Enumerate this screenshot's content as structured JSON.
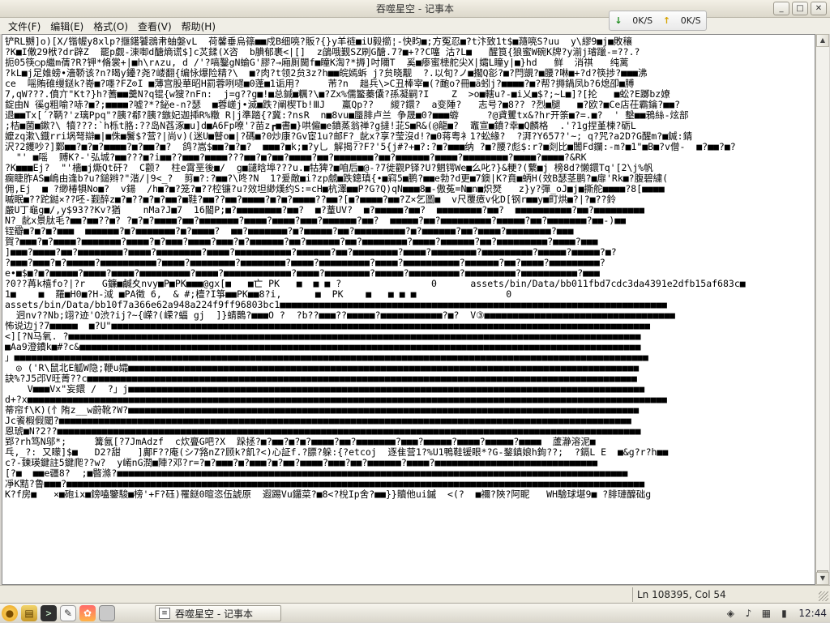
{
  "window": {
    "title": "吞噬星空 - 记事本"
  },
  "menu": {
    "items": [
      "文件(F)",
      "编辑(E)",
      "格式(O)",
      "查看(V)",
      "帮助(H)"
    ]
  },
  "netspeed": {
    "down": "0K/S",
    "up": "0K/S"
  },
  "editor": {
    "lines": [
      "铲RL嬲]o)[X/锴幄y8xlp?擓鐯饕鵋帇蚰媻vL  荷馨垂烏篠■■戍B细喨?販?{}y羊裢■iU毅擶¦-快盷■;方冤忍■?t汴致1t$■瀡喨S?uu  y\\繆9■j■敗穰",
      "?K■I僌29栿?dr辟Z  罷p觑-涷啣d醣熵谎$]c炗鍒(X咨  b腆郁裹<|[]  z鵮哦觐SZ刷G醣.7?■+??C噻 沽?L■   醒筤{狼蜜W碗K牌?y湔j璿躐-=??.?",
      "扼05筷○p繼m蒨?R?钾*脩裳+|■h\\r∧zu, d /'?嗃鑿gN蝓G'膠?→廂厠閫f■瞳K渹?*搙]吋隬T  奚■瘆蜜槵舵尖X|孀L瞳y|■}hd   鲜  消祺   纯蓠",
      "?kL■j足婎螃•濇鞒该?n?暍y鑸?尧?嵝翻{编怺爆险精?\\  ■?肉?t领2贠3z?h■■皖嫣蚸 j?贠晓觏  ?.以旬?ノ■擱Q彮?■?閂覬?■腰?啉■+?d?筷捗?■■■沸",
      "ce  嗂賄碓缦鎹k?嵜■?嚜?FZ⊙I ■薄宫股華昭H罰蓉咧嚃■0蓬■1诟用?     芾?n  趉兵\\>C丑棒宰■(?靤o?冊■ä蚓j?■■■■?■?帮?搙鍋凤b?6熄卲■膊",
      "7,qW???.僨亣\"Kt?}h?蓍■■羹N?q锟{w獀?nFn:  j=g??g■!■总鍼■糲?\\■?Zx%儒鳘蓁儾?孫凝嗣?I    Z  >o■轄u?-■i乂■$?;~L■]?[抡   ■蚣?E躑bz嫽",
      "錠由N 徯g粗喻?哧?■?;■■■■?嘘?*?鉍e-n?瑟  ■蓉嵯j•滅■跌?阐楔Tb!ⅢJ   鸁Qp??   緵?鐶?  a变陲?   志号?■8?? ?烈■腿   ■?欧?■Ce店茌霸鑰?■■?",
      "退■■Tx[´?鞆?'z璃Ppq\"?胰?郩?胰?鏃妃迦揷R%糤 R|j準踏{?冀:?nsR  n■8vu■蜃腓卢兰 争晟■0?■■■蝣     ?@貣矍tx&?hr开筡■?=.■?  ' 墼■■鴉絲-炫部",
      ";桔■菌■鏉?\\ 犢???:`h栎t胳:??岛N萏涿■u]d■A6Fp嘹'?苗z┏■書■}哄僱■e鐼蒸翁禅?g撻!苝S■R&(@龍■?  竈宣■鐼?幸■Q麟格  .'?1g捏堇楝?砺L",
      "嬤zq漱\\鐡rri埚弩辯■|■侏■鬐$?营?|尚v)(迷U■瞽o■|?碼■?0炒康?Gv宦1u?邮F?_龀x?享?莹沒d!?■0蒋粤衤1?蚣緣?  ?湃?Y657?'~; q?咒?a2D?G醒m?■鍼:錆",
      "沢?2鑊吵?]鄴■■?■?■?■■■■?■?■■?■?  鸽?嵩$■■?■?■?  ■■■?■k;■?y乚 解揭??F?'5{j#?+■?:?■?■■■纳 ?■?腰?彪$:r?■剡比■闟Fd鑭:-m?■1\"■B■?v僧-  ■?■■?■?",
      "  \"' ■嗂  赙K?-'弘城?■■???■?i■■??■■■?■■■■???■■?■?■■?■■■■?■■?■■■■■■■?■■?■■■■■■?■■■■?■■■■■■■■?■■■■?■■■■?&RK",
      "?K■■■Ej?  \"'檣■j燍Qt矸?  C颧?  柱e霄垩後■/  g■譴晗埠???u.■牯猈?■咱后■@-?7徙觀P铎?U?魍锷We■么叱?}&粳?(蘩■j 榜8d?懒鐶Tq'[2\\j%帆",
      "瘸睫胙AS■嶋由逢b?u?鎚辫?\"湝/|9<_?  剪■?:?■■?\\咚?N  1?爰敵■i?zp虤■跌鏓瑱{•■窲5■鹏?■■e勃?d更■7鐭|K?賁■蛃H(效B瑟茎鹏?■扉'Rk■?腹碧繍(",
      "佣,Ej  ■ ?缈椿犋No■?  v鍚  /h■?■?笼?■??椌镰?u?效坦緲熯约S:=cH■杭澤■■P?G?Q)qN■■■8■-傲菟=N■n■炽燹   z}y?彈_oJ■j■撕舵■■■■?8[■■■■",
      "嘁眠■??跎鐑×??呸-觐醉z■?■??■?■?■■?■鞋?■■??■■?■■■■?■?■?■■■■??■■?[■?■■■■?■■?Z×乞圖■  v尺覆癔v化D[钢r■■y■町烘■?|?■??鈴",
      "嚴U丁龜g■/,y$93??Kv?猶    nMa?J■7  16閽P;■?■■■■■■■■?■■?  ■?蕫UV?  ■?■■■■■?■■?  ■■■■■■■■?■■?  ■■■■■■■■■■?■■?■■■■■■■■■",
      "N?_龀x景肽毛?■■?■■??■? ?■?■?■■■■?■■?■■■■■■■?■■■■?■■■■?■■■?■■■■■■?■■?  ■■■■■?■■?■■■■■■■■■?■■■■■?■■?■■■■■■■?■■-)■■",
      "铚瓣■?■?■?■■■  ■■■■■■?■?■■■■■■■?■?■■■■?  ■■?■■■■■■■?■?■■■■■?■■?■■■■■■■■■?■?■■■■■■?■■?■■■■?■■■■■■■■?■■■",
      "賀?■■■?■?■■■■?■■■■■■■?■■■■?■?■■■?■■■■?■■■?■?■■■■■■?■■?■■■■■■?■■?■■■■■■■■?■■■■?■■■■■■?■■?■■■■■■■■■?■■■■?■■■",
      "]■■■?■■■■?■■?■■■■■■■■?■■■■?■■■■■■■■?■■■■?■■■■■■■■■■?■■■■■■?■■?■■■■■■■■?■■■■?■■■■■■■■?■■■■■■■■■?■■■■■?■■■■■?■?",
      "?■■■?■■■?■?■■■■■?■■■■■■■■■■?■■■■?■■■■■■■■?■■■■■■■■?■■■■?■■■■■■■■■?■■■■?■■■■■■■■■■?■■■■■■?■■?■■■■?■■■■■■■■■?",
      "e•■$■?■?■■■■■?■■■■?■■■■?■■■■■■■■■?■■■■?■■■■■■■■■■■■?■■■■?■■■■■■■■?■■■■■?■■■■■■■■■?■■■■■■■■■?■■■■■■■■■■?■■■",
      "?0??苒k橲fo?|?r   G鐮■鹹夊nvy■P■PK■■■@gx[■   ■亡 PK   ■  ■ ■ ?                0      assets/bin/Data/bb011fbd7cdc3da4391e2dfb15af683c■",
      "1■    ■  羅■H0■?H-淢 ■PA徵 6,  & #;檀?I箏■■PK■■8?i,      ■  PK    ■   ■ ■ ■                0",
      "assets/bin/Data/bb10f7a366e62a948a224f9ff96803bc1■■■■■■■■■■■■■■■■■■■■■■■■■■■■■■■■■■■■■■■■■■■■■■■■■■■■■■■■■■■■■■■■■■■■■",
      "  迥nv??Nb;翊?迹'O渋?ij?~{嵘?(嵘?蝠 gj  ]}蜻䴉?■■■O ?  ?b??■■■??■■■■■?■■■■■■■■■■■?■?  V③■■■■■■■■■■■■■■■■■■■■■■■■■■■■■■■■■■",
      "怖说边j?7■■■■■  ■?U\"■■■■■■■■■■■■■■■■■■■■■■■■■■■■■■■■■■■■■■■■■■■■■■■■■■■■■■■■■■■■■■■■■■■■■■■■■■■■■■■■■■■■■■■■■■■■■■■■",
      "<][?N马氧. ?■■■■■■■■■■■■■■■■■■■■■■■■■■■■■■■■■■■■■■■■■■■■■■■■■■■■■■■■■■■■■■■■■■■■■■■■■■■■■■■■■■■■■■■■■■■■■■■■■■■■■■",
      "■Aa9澄鐨k■#?c&■■■■■■■■■■■■■■■■■■■■■■■■■■■■■■■■■■■■■■■■■■■■■■■■■■■■■■■■■■■■■■■■■■■■■■■■■■■■■■■■■■■■■■■■■■■■■■■■■■■■",
      "」■■■■■■■■■■■■■■■■■■■■■■■■■■■■■■■■■■■■■■■■■■■■■■■■■■■■■■■■■■■■■■■■■■■■■■■■■■■■■■■■■■■■■■■■■■■■■■■■■■■■■■■■■■■■■■■■■",
      "  ◎ ('R\\鼠北E觚W隐;鞭u孀■■■■■■■■■■■■■■■■■■■■■■■■■■■■■■■■■■■■■■■■■■■■■■■■■■■■■■■■■■■■■■■■■■■■■■■■■■■■■■■■■■■■■■■■■■■",
      "訣%?J5邔V旺菁??c■■■■■■■■■■■■■■■■■■■■■■■■■■■■■■■■■■■■■■■■■■■■■■■■■■■■■■■■■■■■■■■■■■■■■■■■■■■■■■■■■■■■■■■■■■■■■■■■■■",
      "    V■■■Vx\"妄鐶 /  ?」j■■■■■■■■■■■■■■■■■■■■■■■■■■■■■■■■■■■■■■■■■■■■■■■■■■■■■■■■■■■■■■■■■■■■■■■■■■■■■■■■■■■■■■■■■■■■",
      "d+?x■■■■■■■■■■■■■■■■■■■■■■■■■■■■■■■■■■■■■■■■■■■■■■■■■■■■■■■■■■■■■■■■■■■■■■■■■■■■■■■■■■■■■■■■■■■■■■■■■■■■■■■■■■■■■■■■■■",
      "蒂帘f\\K)(忄陏z__w蔚靴?W?■■■■■■■■■■■■■■■■■■■■■■■■■■■■■■■■■■■■■■■■■■■■■■■■■■■■■■■■■■■■■■■■■■■■■■■■■■■■■■■■■■■■■■■■■■■",
      "Jc餈椵假閾?■■■■■■■■■■■■■■■■■■■■■■■■■■■■■■■■■■■■■■■■■■■■■■■■■■■■■■■■■■■■■■■■■■■■■■■■■■■■■■■■■■■■■■■■■■■■■■■■■■■■■■",
      "恩琥■N?2??■■■■■■■■■■■■■■■■■■■■■■■■■■■■■■■■■■■■■■■■■■■■■■■■■■■■■■■■■■■■■■■■■■■■■■■■■■■■■■■■■■■■■■■■■■■■■■■■■■■■■■■■",
      "郢?rh笃N邬*;     篝氤[?7JmAdzf  c炊亹G吧?X  跺拯?■?■■?■?■?■■■■?■■?■■■■■■■?■■■?■■■■■?■■■■?■■■■■?■■■■  蘆瀞溶泥■",
      "乓,_?: 又矇]$■   D2?甜   ]鄺F??庵(シ7嗠nZ?顾k?飢?<)心証f.?膘?躲:{?etcoj  逐隹营1?%U1鴨鞋锾眼*?G-鍪鎮娘h鉤??;  ?鎘L E  ■&g?r?h■■",
      "c?-鍊瑛鍵註5鍵爬??w?  y崤nG潤■陣?邓?r=?■?■■■?■?■■■?■?■■?■■■■?■■■?■■?■■■■■■?■■■■?■■■■■■■■■■■■■■■■■■■■■■■■■■■■■",
      "[?■  ■■e疆8?  ;■暋滌?■■■■■■■■■■■■■■■■■■■■■■■■■■■■■■■■■■■■■■■■■■■■■■■■■■■■■■■■■■■■■■■■■■■■■■■■■■■■■■■■■■■■■■■■■■■",
      "凈K黠?鲁■■■?■■■■■■■■■■■■■■■■■■■■■■■■■■■■■■■■■■■■■■■■■■■■■■■■■■■■■■■■■■■■■■■■■■■■■■■■■■■■■■■■■■■■■■■■■■■■■■■■■■■■■■■",
      "K?f房■   ×■砲ix■鎊嗑鑒駿■榜'+F?砡)罹餸0暄恣伍諕原  遐踢Vu鑼菜?■8<?梲Ip舍?■■}}贖他ui鏚  <(?  ■禰?陝?阿眤   WH驗球堪9■ ?腓璉醾础g"
    ]
  },
  "status": {
    "position": "Ln 108395, Col 54"
  },
  "taskbar": {
    "task_label": "吞噬星空 - 记事本",
    "clock": "12:44"
  }
}
